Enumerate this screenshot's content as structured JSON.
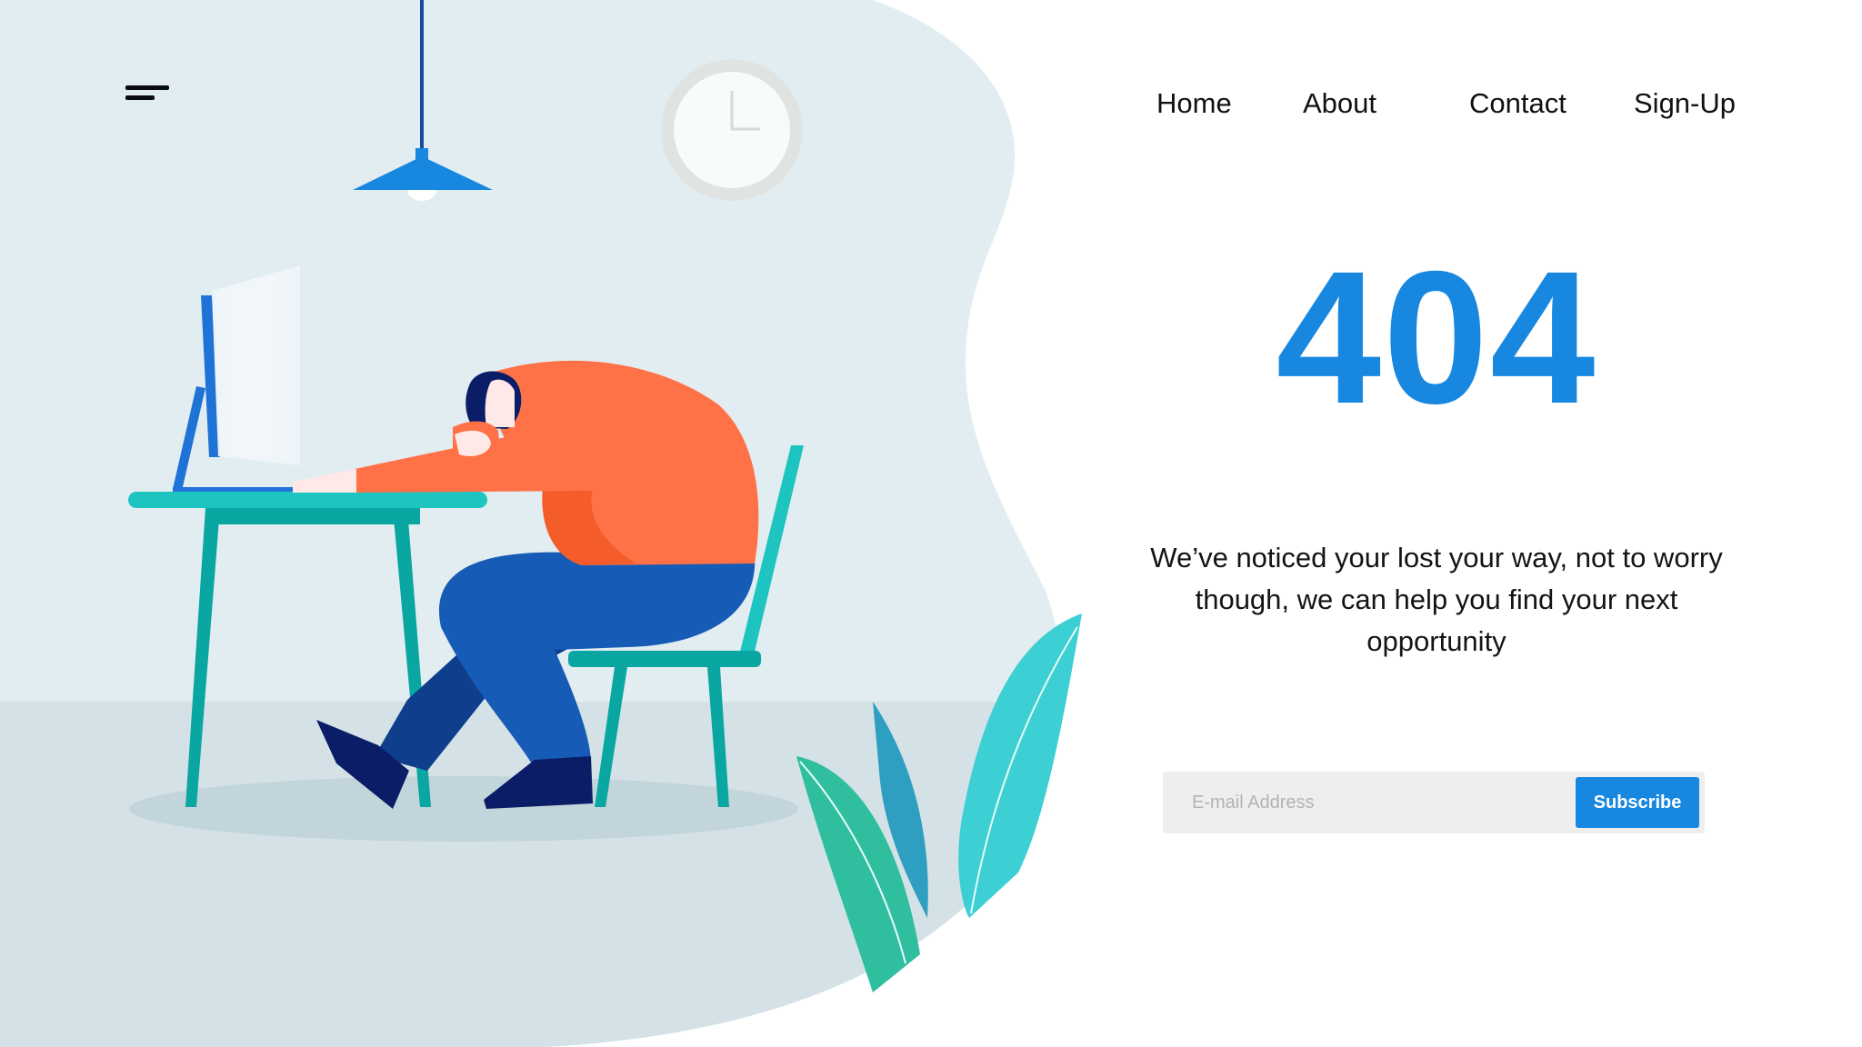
{
  "nav": {
    "items": [
      {
        "label": "Home"
      },
      {
        "label": "About"
      },
      {
        "label": "Contact"
      },
      {
        "label": "Sign-Up"
      }
    ]
  },
  "error": {
    "code": "404",
    "message": "We’ve noticed your lost your way, not to worry though, we can help you find your next opportunity"
  },
  "subscribe": {
    "placeholder": "E-mail Address",
    "value": "",
    "button_label": "Subscribe"
  },
  "illustration": {
    "icons": [
      "menu-icon",
      "pendant-lamp",
      "wall-clock",
      "computer-monitor",
      "desk",
      "chair",
      "tired-person",
      "plant-leaves"
    ]
  },
  "colors": {
    "accent": "#1787e0",
    "wall": "#e2edf2",
    "floor": "#d4e2e7",
    "shirt": "#ff7247",
    "pants": "#165cb6",
    "furniture": "#0aa6a2",
    "leaf_teal": "#2fbf9f",
    "leaf_cyan": "#3ccfd3"
  }
}
